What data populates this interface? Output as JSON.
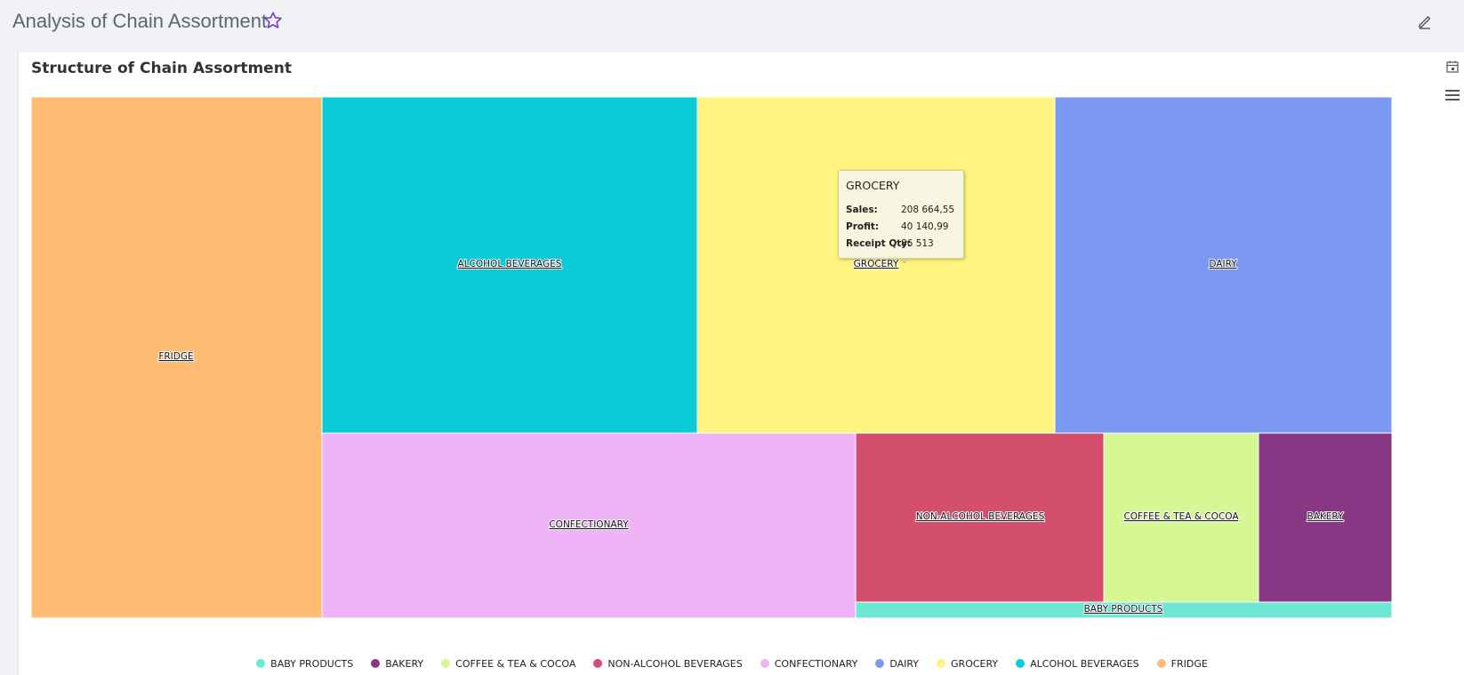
{
  "page": {
    "title": "Analysis of Chain Assortment",
    "favorite_icon": "star-icon",
    "edit_icon": "pencil-icon"
  },
  "card": {
    "title": "Structure of Chain Assortment",
    "date_icon": "calendar-icon",
    "menu_icon": "hamburger-menu-icon"
  },
  "tooltip": {
    "title": "GROCERY",
    "rows": [
      {
        "label": "Sales:",
        "value": "208 664,55"
      },
      {
        "label": "Profit:",
        "value": "40 140,99"
      },
      {
        "label": "Receipt Qty:",
        "value": "86 513"
      }
    ]
  },
  "chart_data": {
    "type": "treemap",
    "title": "Structure of Chain Assortment",
    "legend_position": "bottom",
    "series": [
      {
        "name": "FRIDGE",
        "color": "#FFBC73"
      },
      {
        "name": "ALCOHOL BEVERAGES",
        "color": "#0BCBD9"
      },
      {
        "name": "GROCERY",
        "color": "#FFF47F",
        "sales": 208664.55,
        "profit": 40140.99,
        "receipt_qty": 86513
      },
      {
        "name": "DAIRY",
        "color": "#7B99F1"
      },
      {
        "name": "CONFECTIONARY",
        "color": "#EFB4F6"
      },
      {
        "name": "NON-ALCOHOL BEVERAGES",
        "color": "#D44E6E"
      },
      {
        "name": "COFFEE & TEA & COCOA",
        "color": "#D5F794"
      },
      {
        "name": "BAKERY",
        "color": "#873784"
      },
      {
        "name": "BABY PRODUCTS",
        "color": "#6CE8D5"
      }
    ],
    "legend": [
      {
        "name": "BABY PRODUCTS",
        "color": "#6CE8D5"
      },
      {
        "name": "BAKERY",
        "color": "#873784"
      },
      {
        "name": "COFFEE & TEA & COCOA",
        "color": "#D5F794"
      },
      {
        "name": "NON-ALCOHOL BEVERAGES",
        "color": "#D44E6E"
      },
      {
        "name": "CONFECTIONARY",
        "color": "#EFB4F6"
      },
      {
        "name": "DAIRY",
        "color": "#7B99F1"
      },
      {
        "name": "GROCERY",
        "color": "#FFF47F"
      },
      {
        "name": "ALCOHOL BEVERAGES",
        "color": "#0BCBD9"
      },
      {
        "name": "FRIDGE",
        "color": "#FFBC73"
      }
    ]
  }
}
